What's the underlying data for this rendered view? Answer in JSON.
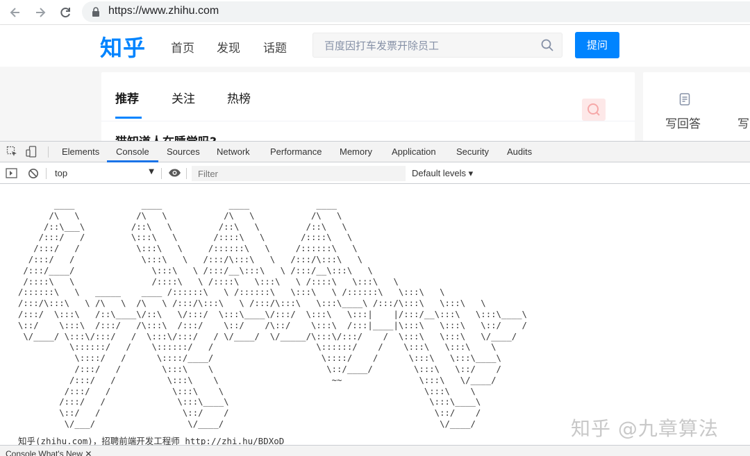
{
  "browser": {
    "url": "https://www.zhihu.com"
  },
  "zhihu": {
    "logo": "知乎",
    "nav": [
      "首页",
      "发现",
      "话题"
    ],
    "search_placeholder": "百度因打车发票开除员工",
    "ask_button": "提问",
    "tabs": [
      "推荐",
      "关注",
      "热榜"
    ],
    "question_title": "猫知道人在睡觉吗?",
    "side": {
      "write_answer": "写回答",
      "write_more": "写"
    },
    "accent_color": "#0084ff"
  },
  "devtools": {
    "tabs": [
      "Elements",
      "Console",
      "Sources",
      "Network",
      "Performance",
      "Memory",
      "Application",
      "Security",
      "Audits"
    ],
    "active_tab": "Console",
    "context": "top",
    "filter_placeholder": "Filter",
    "levels": "Default levels ▾",
    "console": {
      "ascii_art": "       ____             ____             ____             ____\n      /\\   \\           /\\   \\           /\\   \\           /\\   \\\n     /::\\___\\         /::\\   \\         /::\\   \\         /::\\   \\\n    /:::/   /         \\:::\\   \\       /::::\\   \\       /::::\\   \\\n   /:::/   /           \\:::\\   \\     /::::::\\   \\     /::::::\\   \\\n  /:::/   /             \\:::\\   \\   /:::/\\:::\\   \\   /:::/\\:::\\   \\\n /:::/____/               \\:::\\   \\ /:::/__\\:::\\   \\ /:::/__\\:::\\   \\\n /::::\\   \\               /::::\\   \\ /::::\\   \\:::\\   \\ /::::\\   \\:::\\   \\\n/::::::\\   \\   _____    ____ /::::::\\   \\ /::::::\\   \\:::\\   \\ /::::::\\   \\:::\\   \\\n/:::/\\:::\\   \\ /\\   \\  /\\   \\ /:::/\\:::\\   \\ /:::/\\:::\\   \\:::\\____\\ /:::/\\:::\\   \\:::\\   \\\n/:::/  \\:::\\   /::\\____\\/::\\   \\/:::/  \\:::\\____\\/:::/  \\:::\\   \\:::|    |/:::/__\\:::\\   \\:::\\____\\\n\\::/    \\:::\\  /:::/   /\\:::\\  /:::/    \\::/    /\\::/    \\:::\\  /:::|____|\\:::\\   \\:::\\   \\::/    /\n \\/____/ \\:::\\/:::/   /  \\:::\\/:::/   / \\/____/  \\/_____/\\:::\\/:::/    /  \\:::\\   \\:::\\   \\/____/\n          \\::::::/   /    \\::::::/   /                    \\::::::/    /    \\:::\\   \\:::\\    \\\n           \\::::/   /      \\::::/____/                     \\::::/    /      \\:::\\   \\:::\\____\\\n           /:::/   /        \\:::\\    \\                      \\::/____/        \\:::\\   \\::/    /\n          /:::/   /          \\:::\\    \\                      ~~               \\:::\\   \\/____/\n         /:::/   /            \\:::\\    \\                                       \\:::\\    \\\n        /:::/   /              \\:::\\____\\                                       \\:::\\____\\\n        \\::/   /                \\::/    /                                        \\::/    /\n         \\/___/                  \\/____/                                          \\/____/",
      "recruit_prefix": "知乎(zhihu.com)，招聘前端开发工程师 ",
      "recruit_link": "http://zhi.hu/BDXoD"
    },
    "drawer": "Console   What's New ✕"
  },
  "watermark": "知乎 @九章算法"
}
